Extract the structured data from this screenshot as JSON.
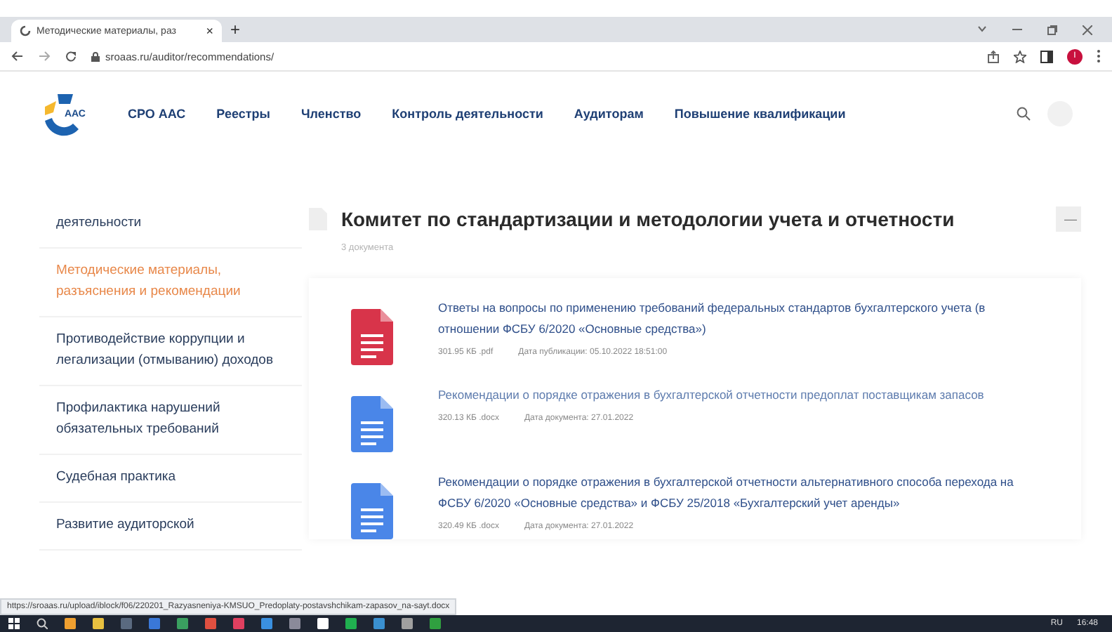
{
  "browser": {
    "tab_title": "Методические материалы, раз",
    "tab_close": "×",
    "new_tab": "+",
    "url": "sroaas.ru/auditor/recommendations/",
    "profile_letter": "I"
  },
  "site_nav": {
    "items": [
      "СРО ААС",
      "Реестры",
      "Членство",
      "Контроль деятельности",
      "Аудиторам",
      "Повышение квалификации"
    ],
    "logo_text": "ААС"
  },
  "sidebar": {
    "items": [
      {
        "label": "деятельности",
        "selected": false
      },
      {
        "label": "Методические материалы, разъяснения и рекомендации",
        "selected": true
      },
      {
        "label": "Противодействие коррупции и легализации (отмыванию) доходов",
        "selected": false
      },
      {
        "label": "Профилактика нарушений обязательных требований",
        "selected": false
      },
      {
        "label": "Судебная практика",
        "selected": false
      },
      {
        "label": "Развитие аудиторской",
        "selected": false
      }
    ]
  },
  "section": {
    "title": "Комитет по стандартизации и методологии учета и отчетности",
    "count": "3 документа",
    "collapse": "—"
  },
  "documents": [
    {
      "kind": "pdf",
      "title": "Ответы на вопросы по применению требований федеральных стандартов бухгалтерского учета (в отношении ФСБУ 6/2020 «Основные средства»)",
      "size": "301.95 КБ .pdf",
      "date": "Дата публикации: 05.10.2022 18:51:00"
    },
    {
      "kind": "docx",
      "title": "Рекомендации о порядке отражения в бухгалтерской отчетности предоплат поставщикам запасов",
      "size": "320.13 КБ .docx",
      "date": "Дата документа: 27.01.2022"
    },
    {
      "kind": "docx",
      "title": "Рекомендации о порядке отражения в бухгалтерской отчетности альтернативного способа перехода на ФСБУ 6/2020 «Основные средства» и ФСБУ 25/2018 «Бухгалтерский учет аренды»",
      "size": "320.49 КБ .docx",
      "date": "Дата документа: 27.01.2022"
    }
  ],
  "status_url": "https://sroaas.ru/upload/iblock/f06/220201_Razyasneniya-KMSUO_Predoplaty-postavshchikam-zapasov_na-sayt.docx",
  "taskbar": {
    "language": "RU",
    "time": "16:48"
  }
}
